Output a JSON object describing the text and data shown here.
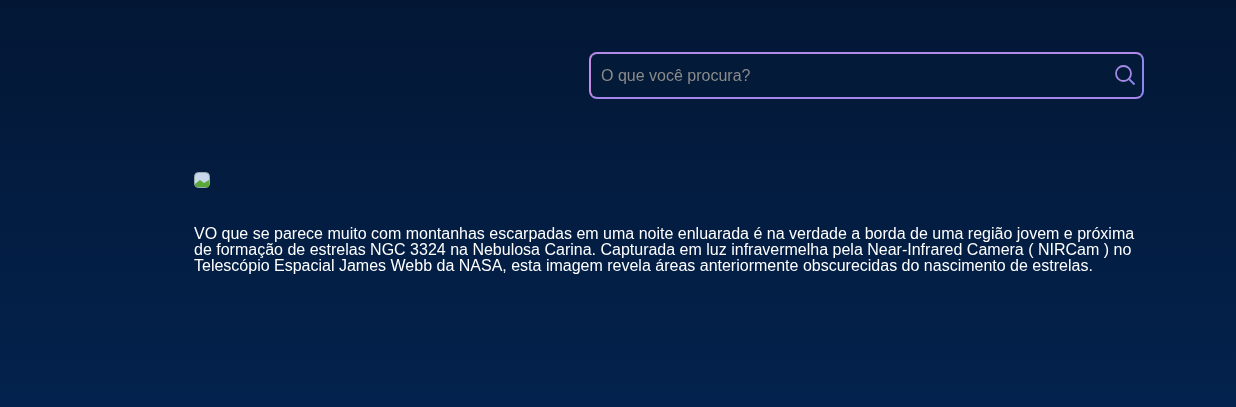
{
  "search": {
    "placeholder": "O que você procura?"
  },
  "image": {
    "kind": "broken-image"
  },
  "description": "VO que se parece muito com montanhas escarpadas em uma noite enluarada é na verdade a borda de uma região jovem e próxima de formação de estrelas NGC 3324 na Nebulosa Carina. Capturada em luz infravermelha pela Near-Infrared Camera ( NIRCam ) no Telescópio Espacial James Webb da NASA, esta imagem revela áreas anteriormente obscurecidas do nascimento de estrelas."
}
